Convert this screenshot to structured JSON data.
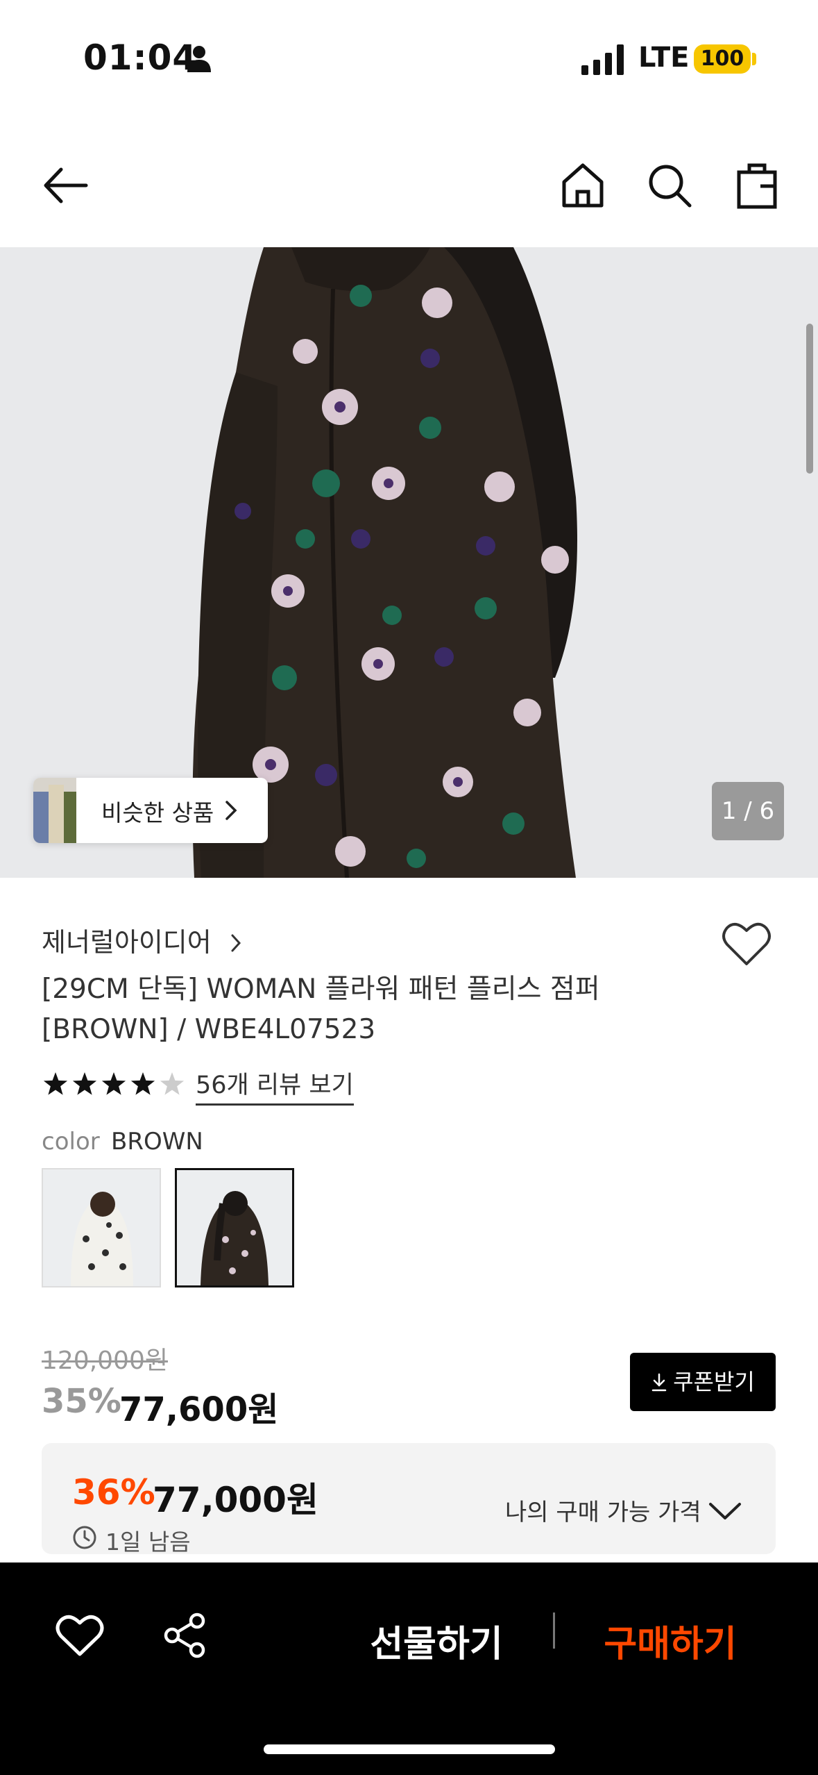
{
  "status_bar": {
    "time": "01:04",
    "network": "LTE",
    "battery": "100"
  },
  "nav": {
    "back": "back-arrow-icon",
    "home": "home-icon",
    "search": "search-icon",
    "bag": "shopping-bag-icon"
  },
  "hero": {
    "similar_label": "비슷한 상품",
    "counter": "1 / 6"
  },
  "product": {
    "brand": "제너럴아이디어",
    "title_line1": "[29CM 단독] WOMAN 플라워 패턴 플리스 점퍼",
    "title_line2": "[BROWN] / WBE4L07523",
    "rating": 4,
    "rating_max": 5,
    "review_link": "56개 리뷰 보기",
    "color_label": "color",
    "color_value": "BROWN",
    "original_price": "120,000원",
    "discount": "35%",
    "price": "77,600원",
    "coupon_button": "쿠폰받기"
  },
  "my_price": {
    "discount": "36%",
    "price": "77,000원",
    "time_left": "1일 남음",
    "label": "나의 구매 가능 가격"
  },
  "bottom_bar": {
    "gift": "선물하기",
    "buy": "구매하기"
  },
  "colors": {
    "accent": "#ff4800",
    "dark": "#000000",
    "jacket": "#2e2620"
  }
}
